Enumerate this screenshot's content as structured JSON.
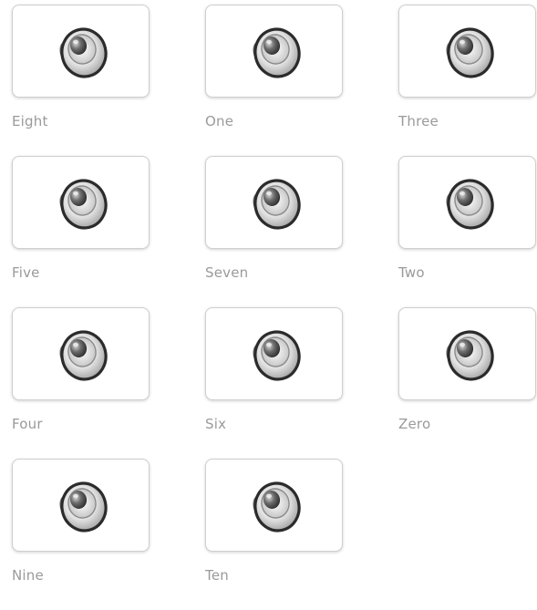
{
  "items": [
    {
      "label": "Eight",
      "icon": "speaker-icon"
    },
    {
      "label": "One",
      "icon": "speaker-icon"
    },
    {
      "label": "Three",
      "icon": "speaker-icon"
    },
    {
      "label": "Five",
      "icon": "speaker-icon"
    },
    {
      "label": "Seven",
      "icon": "speaker-icon"
    },
    {
      "label": "Two",
      "icon": "speaker-icon"
    },
    {
      "label": "Four",
      "icon": "speaker-icon"
    },
    {
      "label": "Six",
      "icon": "speaker-icon"
    },
    {
      "label": "Zero",
      "icon": "speaker-icon"
    },
    {
      "label": "Nine",
      "icon": "speaker-icon"
    },
    {
      "label": "Ten",
      "icon": "speaker-icon"
    }
  ],
  "colors": {
    "label_text": "#9a9a9a",
    "tile_border": "#cfcfcf"
  }
}
